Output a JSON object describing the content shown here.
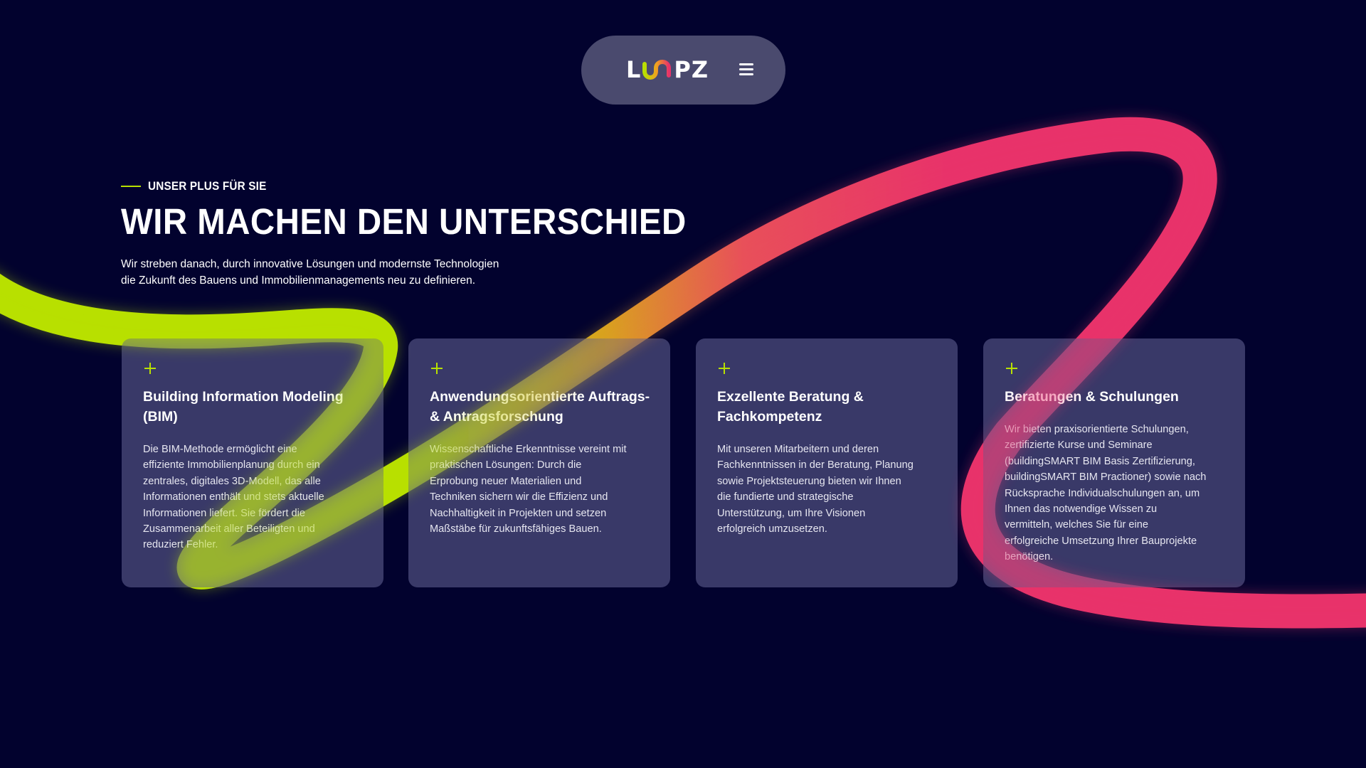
{
  "header": {
    "logo_text": "LOOPZ",
    "logo_left": "L",
    "logo_right": "PZ",
    "menu_icon": "hamburger-menu-icon"
  },
  "hero": {
    "eyebrow": "UNSER PLUS FÜR SIE",
    "headline": "WIR MACHEN DEN UNTERSCHIED",
    "intro_lines": [
      "Wir streben danach, durch innovative Lösungen und modernste Technologien",
      "die Zukunft des Bauens und Immobilienmanagements neu zu definieren."
    ]
  },
  "cards": [
    {
      "icon": "plus-icon",
      "title_lines": [
        "Building Information Modeling",
        "(BIM)"
      ],
      "text_lines": [
        "Die BIM-Methode ermöglicht eine",
        "effiziente Immobilienplanung durch ein",
        "zentrales, digitales 3D-Modell, das alle",
        "Informationen enthält und stets aktuelle",
        "Informationen liefert. Sie fördert die",
        "Zusammenarbeit aller Beteiligten und",
        "reduziert Fehler."
      ]
    },
    {
      "icon": "plus-icon",
      "title_lines": [
        "Anwendungsorientierte Auftrags-",
        "& Antragsforschung"
      ],
      "text_lines": [
        "Wissenschaftliche Erkenntnisse vereint mit",
        "praktischen Lösungen: Durch die",
        "Erprobung neuer Materialien und",
        "Techniken sichern wir die Effizienz und",
        "Nachhaltigkeit in Projekten und setzen",
        "Maßstäbe für zukunftsfähiges Bauen."
      ]
    },
    {
      "icon": "plus-icon",
      "title_lines": [
        "Exzellente Beratung  &",
        "Fachkompetenz"
      ],
      "text_lines": [
        "Mit unseren Mitarbeitern und deren",
        "Fachkenntnissen in der Beratung, Planung",
        "sowie Projektsteuerung bieten wir Ihnen",
        "die fundierte und strategische",
        "Unterstützung, um Ihre Visionen",
        "erfolgreich umzusetzen."
      ]
    },
    {
      "icon": "plus-icon",
      "title_lines": [
        "Beratungen & Schulungen"
      ],
      "text_lines": [
        "Wir bieten praxisorientierte Schulungen,",
        "zertifizierte Kurse und Seminare",
        "(buildingSMART BIM Basis Zertifizierung,",
        "buildingSMART BIM Practioner) sowie nach",
        "Rücksprache Individualschulungen an, um",
        "Ihnen das notwendige Wissen zu",
        "vermitteln, welches Sie für eine",
        "erfolgreiche Umsetzung Ihrer Bauprojekte",
        "benötigen."
      ]
    }
  ],
  "colors": {
    "background": "#02022e",
    "accent_green": "#b8e000",
    "accent_pink": "#e8336a",
    "card_bg": "#55558a",
    "nav_bg": "#4a4a6e"
  }
}
